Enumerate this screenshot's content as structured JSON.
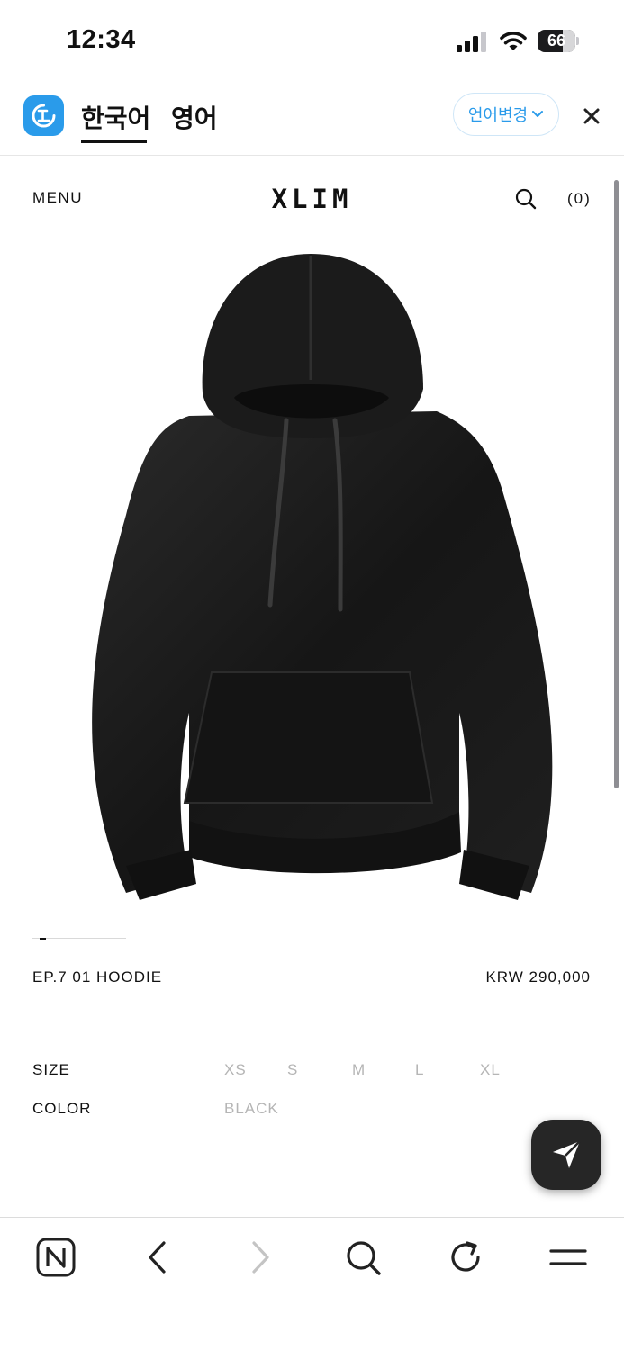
{
  "status_bar": {
    "time": "12:34",
    "battery": "66",
    "battery_fraction": 0.66,
    "icons": [
      "cellular-signal-icon",
      "wifi-icon",
      "battery-icon"
    ]
  },
  "translate_bar": {
    "tabs": [
      {
        "label": "한국어",
        "active": true
      },
      {
        "label": "영어",
        "active": false
      }
    ],
    "change_language_label": "언어변경",
    "accent_color": "#2a9bea",
    "icons": [
      "translate-app-logo-icon",
      "chevron-down-icon",
      "close-icon"
    ]
  },
  "site_header": {
    "menu_label": "MENU",
    "brand": "XLIM",
    "cart_label": "(0)",
    "icons": [
      "search-icon"
    ]
  },
  "product": {
    "image": "black-hoodie-product-photo",
    "gallery_position": "1",
    "name": "EP.7 01 HOODIE",
    "price": "KRW 290,000",
    "size_label": "SIZE",
    "sizes": [
      "XS",
      "S",
      "M",
      "L",
      "XL"
    ],
    "color_label": "COLOR",
    "colors": [
      "BLACK"
    ]
  },
  "floating_action": {
    "icon": "send-icon"
  },
  "browser_toolbar": {
    "buttons": [
      "naver-home-icon",
      "back-icon",
      "forward-icon",
      "search-icon",
      "reload-icon",
      "menu-icon"
    ]
  }
}
